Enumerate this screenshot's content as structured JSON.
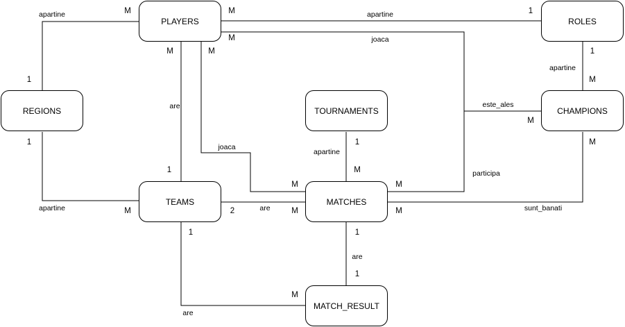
{
  "entities": {
    "players": "PLAYERS",
    "roles": "ROLES",
    "regions": "REGIONS",
    "tournaments": "TOURNAMENTS",
    "champions": "CHAMPIONS",
    "teams": "TEAMS",
    "matches": "MATCHES",
    "match_result": "MATCH_RESULT"
  },
  "relations": {
    "regions_players": {
      "label": "apartine",
      "card_a": "1",
      "card_b": "M"
    },
    "players_roles": {
      "label": "apartine",
      "card_a": "M",
      "card_b": "1"
    },
    "players_champions_joaca": {
      "label": "joaca",
      "card_a": "M"
    },
    "players_teams": {
      "label": "are",
      "card_a": "M",
      "card_b": "1"
    },
    "players_matches": {
      "label": "joaca",
      "card_a": "M",
      "card_b": "M"
    },
    "roles_champions": {
      "label": "apartine",
      "card_a": "1",
      "card_b": "M"
    },
    "matches_champions_este_ales": {
      "label": "este_ales",
      "card_a": "M"
    },
    "matches_participa": {
      "label": "participa",
      "card_a": "M"
    },
    "regions_teams": {
      "label": "apartine",
      "card_a": "1",
      "card_b": "M"
    },
    "teams_matches": {
      "label": "are",
      "card_a": "2",
      "card_b": "M"
    },
    "tournaments_matches": {
      "label": "apartine",
      "card_a": "1",
      "card_b": "M"
    },
    "matches_champions_sunt_banati": {
      "label": "sunt_banati",
      "card_a": "M",
      "card_b": "M"
    },
    "matches_match_result": {
      "label": "are",
      "card_a": "1",
      "card_b": "1"
    },
    "teams_match_result": {
      "label": "are",
      "card_a": "1",
      "card_b": "M"
    }
  }
}
